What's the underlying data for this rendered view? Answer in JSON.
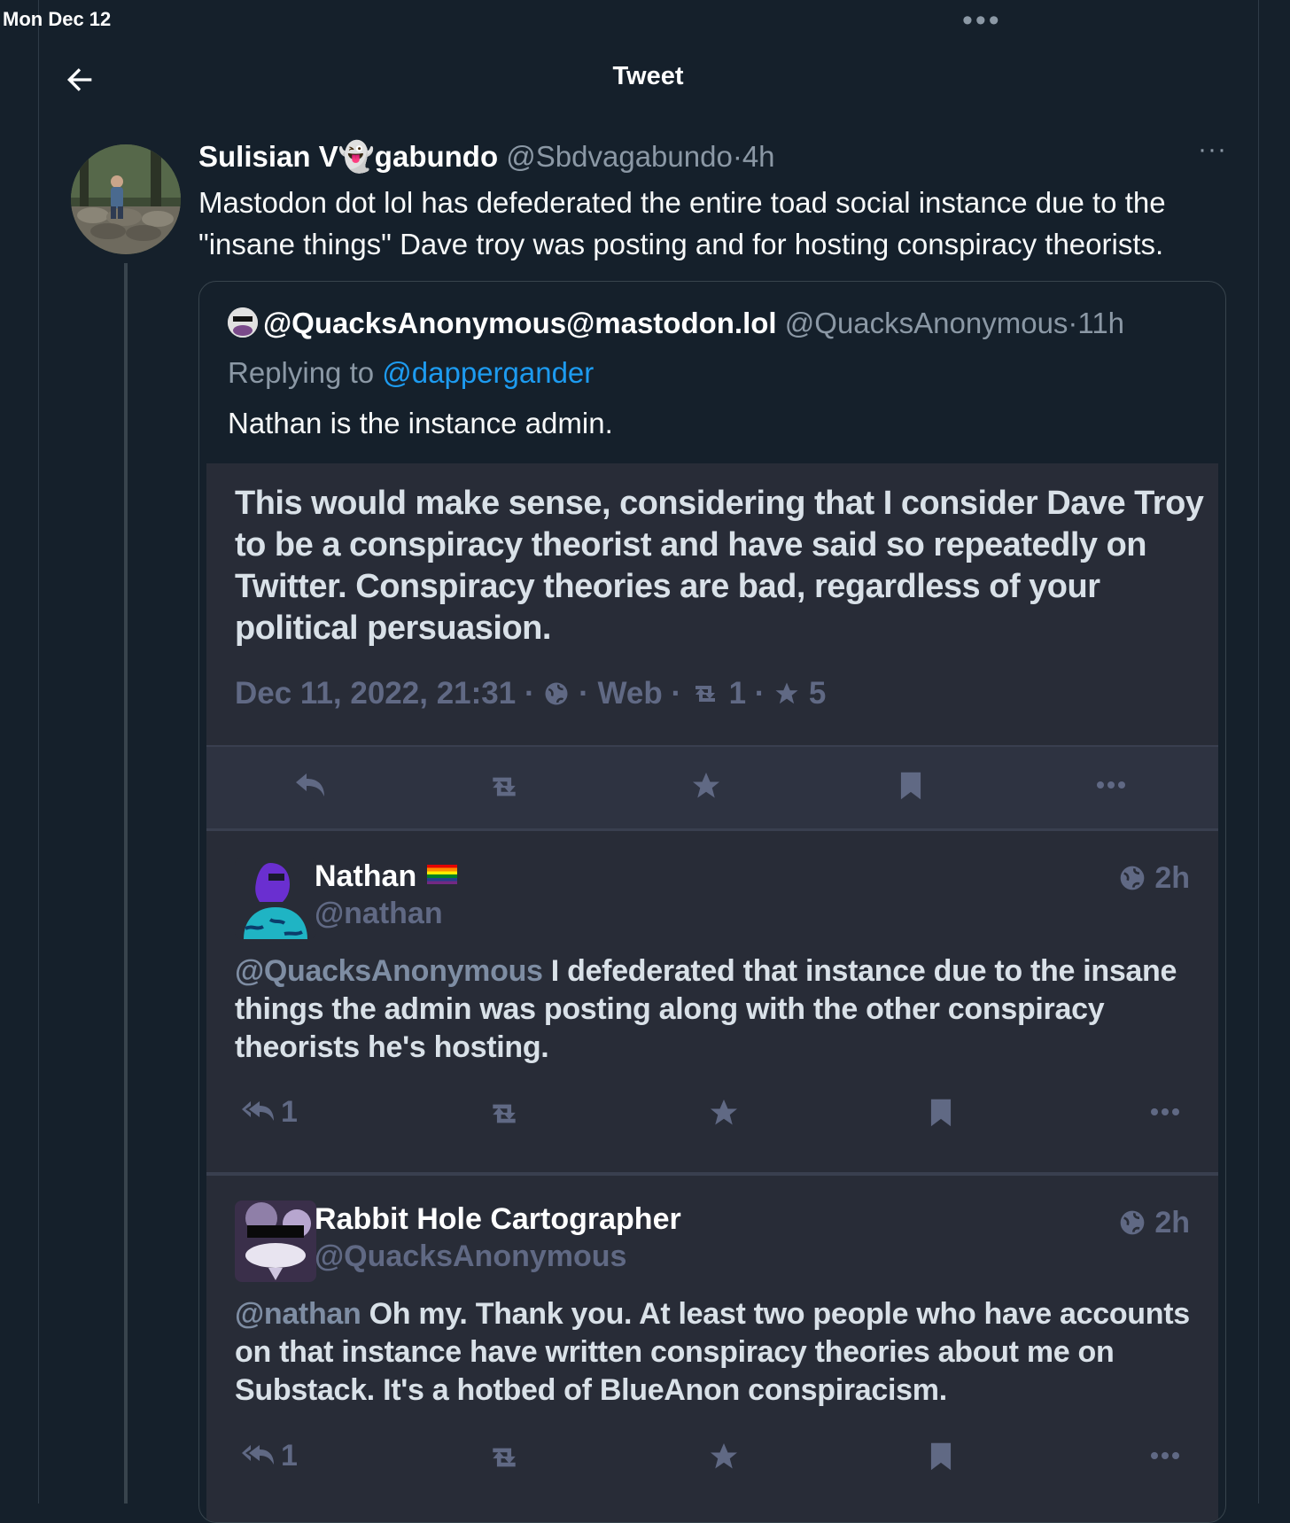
{
  "status_bar": {
    "time": "Mon Dec 12",
    "multitask_dots": "•••"
  },
  "header": {
    "title": "Tweet"
  },
  "tweet": {
    "author_name": "Sulisian V👻gabundo",
    "handle": "@Sbdvagabundo",
    "separator": "·",
    "time": "4h",
    "more": "···",
    "text": "Mastodon dot lol has defederated the entire toad social instance due to the \"insane things\" Dave troy was posting and for hosting conspiracy theorists."
  },
  "quote": {
    "author_name": "@QuacksAnonymous@mastodon.lol",
    "handle": "@QuacksAnonymous",
    "separator": "·",
    "time": "11h",
    "replying_prefix": "Replying to ",
    "replying_to": "@dappergander",
    "text": "Nathan is the instance admin."
  },
  "screenshot": {
    "main_post": {
      "text": "This would make sense, considering that I consider Dave Troy to be a conspiracy theorist and have said so repeatedly on Twitter. Conspiracy theories are bad, regardless of your political persuasion.",
      "date": "Dec 11, 2022, 21:31",
      "sep": "·",
      "client": "Web",
      "boosts": "1",
      "favourites": "5"
    },
    "replies": [
      {
        "name": "Nathan",
        "handle": "@nathan",
        "time": "2h",
        "mention": "@QuacksAnonymous",
        "text": " I defederated that instance due to the insane things the admin was posting along with the other conspiracy theorists he's hosting.",
        "reply_count": "1"
      },
      {
        "name": "Rabbit Hole Cartographer",
        "handle": "@QuacksAnonymous",
        "time": "2h",
        "mention": "@nathan",
        "text": " Oh my. Thank you. At least two people who have accounts on that instance have written conspiracy theories about me on Substack. It's a hotbed of BlueAnon conspiracism.",
        "reply_count": "1"
      }
    ]
  },
  "colors": {
    "background": "#15202b",
    "accent": "#1d9bf0",
    "mastodon_panel": "#282c37",
    "mastodon_muted": "#606984"
  }
}
